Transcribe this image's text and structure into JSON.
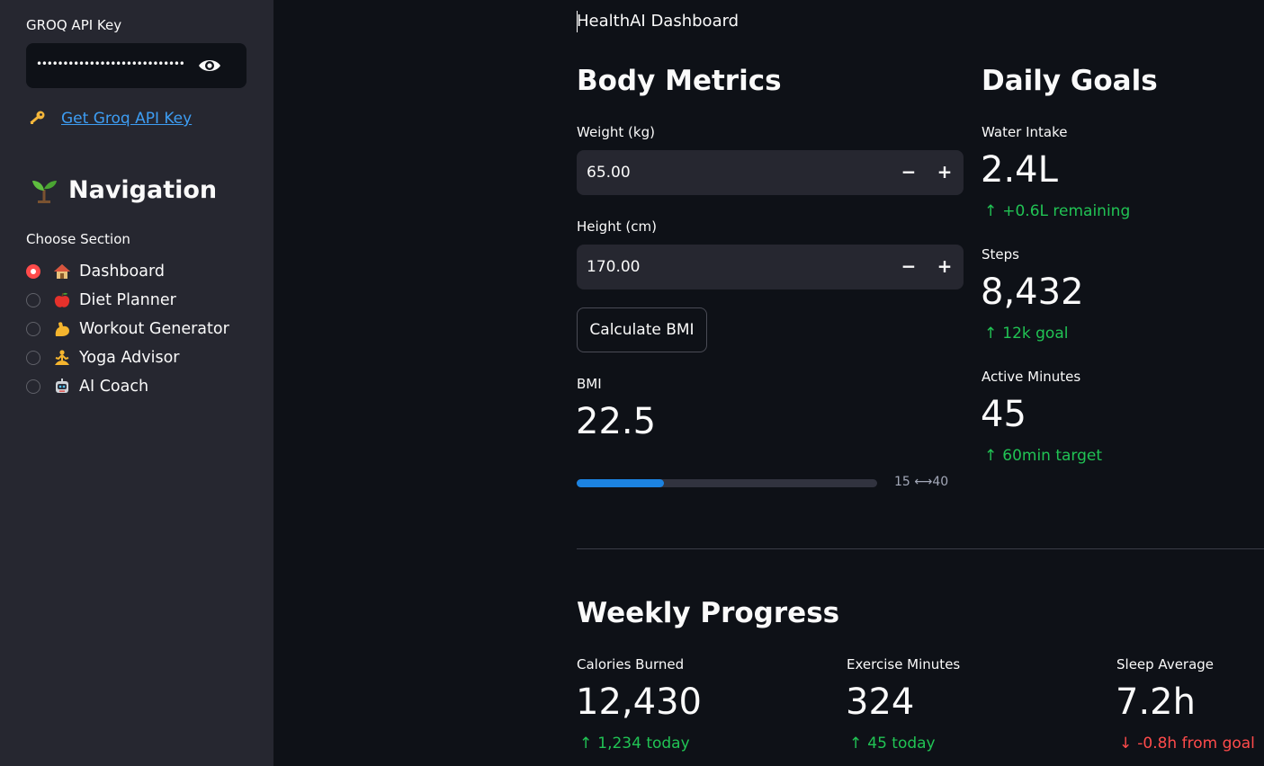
{
  "sidebar": {
    "api_key_label": "GROQ API Key",
    "api_key_value": "••••••••••••••••••••••••••••",
    "key_link": "Get Groq API Key",
    "nav_title": "Navigation",
    "choose_label": "Choose Section",
    "items": [
      {
        "label": "Dashboard",
        "icon": "house-icon",
        "selected": true
      },
      {
        "label": "Diet Planner",
        "icon": "apple-icon",
        "selected": false
      },
      {
        "label": "Workout Generator",
        "icon": "flexed-bicep-icon",
        "selected": false
      },
      {
        "label": "Yoga Advisor",
        "icon": "yoga-person-icon",
        "selected": false
      },
      {
        "label": "AI Coach",
        "icon": "robot-icon",
        "selected": false
      }
    ]
  },
  "main": {
    "app_title": "HealthAI Dashboard",
    "body_metrics": {
      "title": "Body Metrics",
      "weight_label": "Weight (kg)",
      "weight_value": "65.00",
      "height_label": "Height (cm)",
      "height_value": "170.00",
      "calc_button": "Calculate BMI",
      "bmi_label": "BMI",
      "bmi_value": "22.5",
      "bmi_progress": 0.29,
      "bmi_range": "15 ⟷40"
    },
    "daily_goals": {
      "title": "Daily Goals",
      "water_label": "Water Intake",
      "water_value": "2.4L",
      "water_delta": "+0.6L remaining",
      "steps_label": "Steps",
      "steps_value": "8,432",
      "steps_delta": "12k goal",
      "active_label": "Active Minutes",
      "active_value": "45",
      "active_delta": "60min target"
    },
    "weekly": {
      "title": "Weekly Progress",
      "calories_label": "Calories Burned",
      "calories_value": "12,430",
      "calories_delta": "1,234 today",
      "exercise_label": "Exercise Minutes",
      "exercise_value": "324",
      "exercise_delta": "45 today",
      "sleep_label": "Sleep Average",
      "sleep_value": "7.2h",
      "sleep_delta": "-0.8h from goal"
    }
  },
  "colors": {
    "up": "#21c354",
    "down": "#ff4b4b",
    "accent": "#ff4b4b",
    "link": "#3d9df3",
    "progress": "#1c83e1"
  }
}
